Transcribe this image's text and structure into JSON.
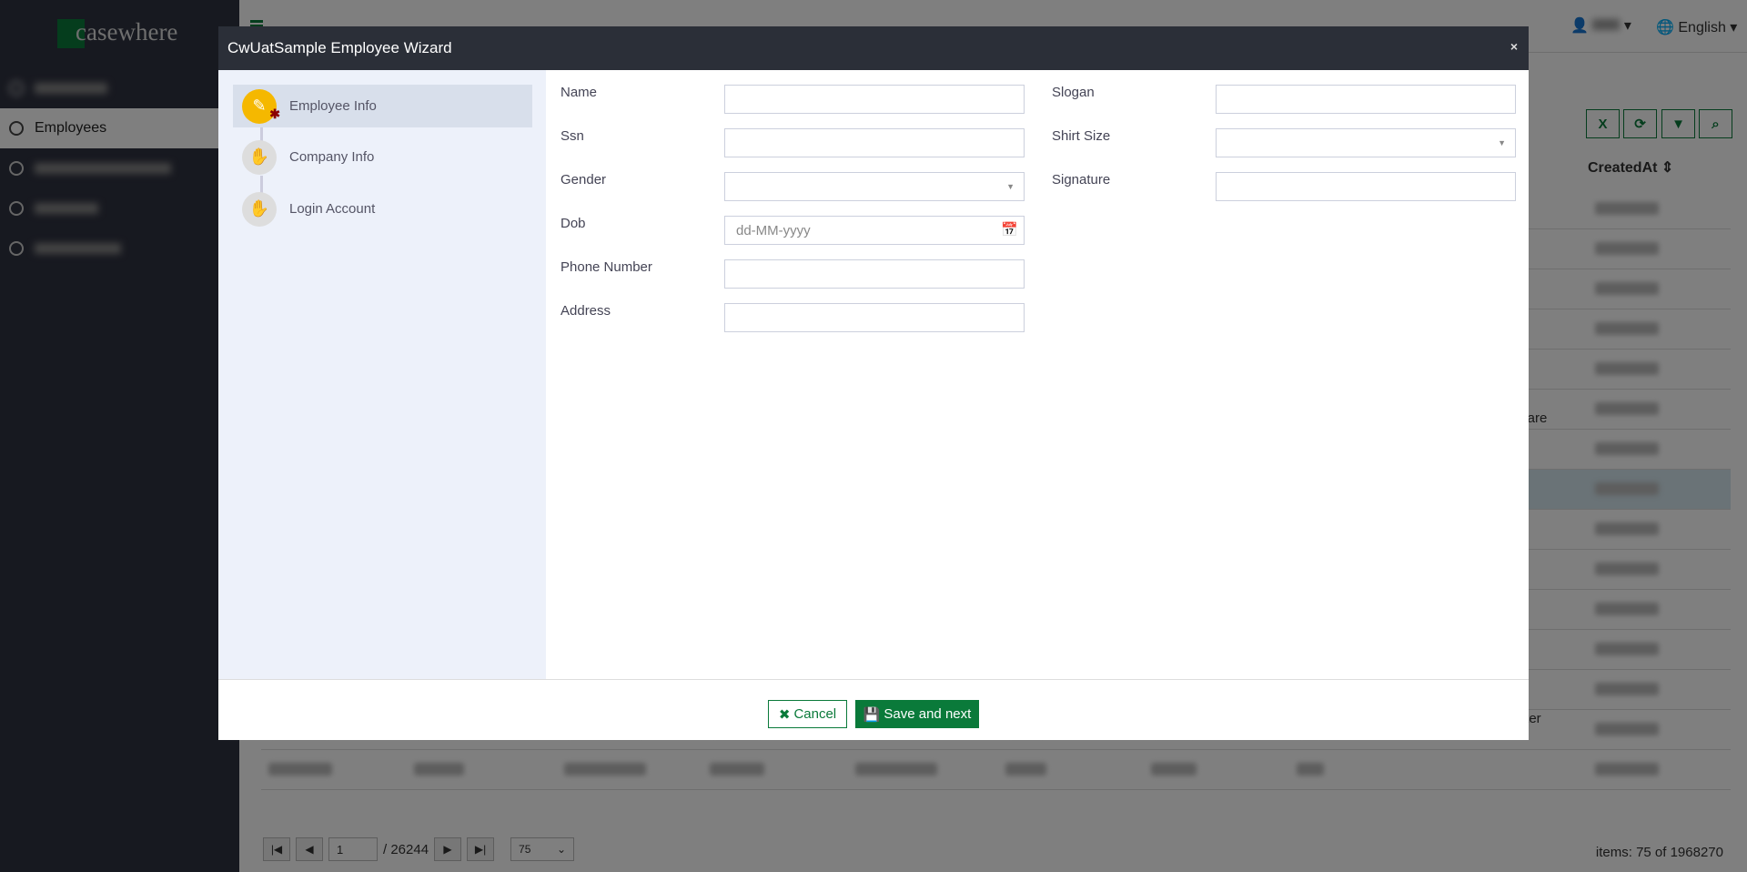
{
  "app": {
    "logo_text": "casewhere",
    "brand_color": "#0a7a3a"
  },
  "sidebar": {
    "items": [
      {
        "label": "Employees",
        "active": true
      }
    ]
  },
  "topbar": {
    "language": "English",
    "user_icon": "user-icon",
    "globe_icon": "globe-icon"
  },
  "toolbar": {
    "icons": [
      "excel-export-icon",
      "refresh-icon",
      "filter-icon",
      "search-icon"
    ]
  },
  "table": {
    "column_header": "CreatedAt",
    "partial_texts": [
      "peare",
      "tter"
    ]
  },
  "pagination": {
    "page": "1",
    "total_pages": "/ 26244",
    "page_size": "75",
    "items_text": "items: 75 of 1968270"
  },
  "modal": {
    "title": "CwUatSample Employee Wizard",
    "close": "×",
    "steps": [
      {
        "label": "Employee Info",
        "active": true
      },
      {
        "label": "Company Info"
      },
      {
        "label": "Login Account"
      }
    ],
    "fields": {
      "name": "Name",
      "ssn": "Ssn",
      "gender": "Gender",
      "dob": "Dob",
      "dob_placeholder": "dd-MM-yyyy",
      "phone": "Phone Number",
      "address": "Address",
      "slogan": "Slogan",
      "shirt_size": "Shirt Size",
      "signature": "Signature"
    },
    "cancel_label": "Cancel",
    "save_label": "Save and next"
  }
}
